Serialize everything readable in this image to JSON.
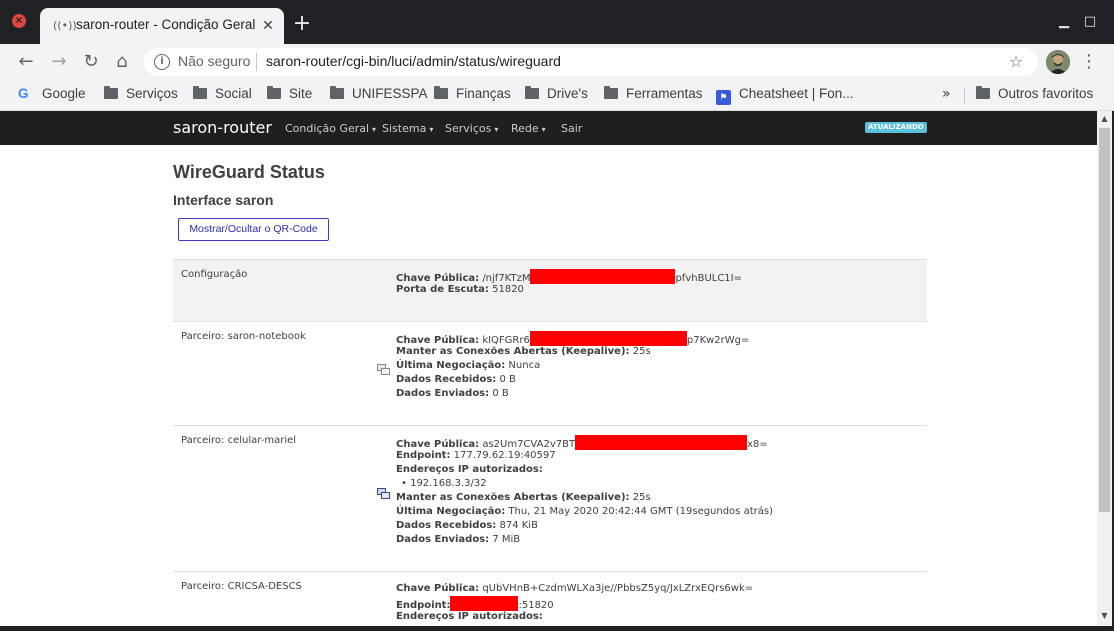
{
  "browser": {
    "tab_title": "saron-router - Condição Geral - LuCI",
    "tab_icon": "radio-waves-icon",
    "new_tab_label": "+",
    "security_text": "Não seguro",
    "url": "saron-router/cgi-bin/luci/admin/status/wireguard",
    "bookmarks": [
      {
        "label": "Google",
        "icon": "google-icon"
      },
      {
        "label": "Serviços",
        "icon": "folder-icon"
      },
      {
        "label": "Social",
        "icon": "folder-icon"
      },
      {
        "label": "Site",
        "icon": "folder-icon"
      },
      {
        "label": "UNIFESSPA",
        "icon": "folder-icon"
      },
      {
        "label": "Finanças",
        "icon": "folder-icon"
      },
      {
        "label": "Drive's",
        "icon": "folder-icon"
      },
      {
        "label": "Ferramentas",
        "icon": "folder-icon"
      },
      {
        "label": "Cheatsheet | Fon...",
        "icon": "flag-icon"
      }
    ],
    "bookmarks_more": "»",
    "other_bookmarks": "Outros favoritos"
  },
  "luci": {
    "brand": "saron-router",
    "nav": [
      {
        "label": "Condição Geral"
      },
      {
        "label": "Sistema"
      },
      {
        "label": "Serviços"
      },
      {
        "label": "Rede"
      },
      {
        "label": "Sair"
      }
    ],
    "badge": "ATUALIZANDO"
  },
  "main": {
    "title": "WireGuard Status",
    "interface_title": "Interface saron",
    "qr_button": "Mostrar/Ocultar o QR-Code",
    "config": {
      "label": "Configuração",
      "pubkey_label": "Chave Pública:",
      "pubkey_start": "/njf7KTzM",
      "pubkey_end": "pfvhBULC1I=",
      "port_label": "Porta de Escuta:",
      "port": "51820"
    },
    "peers": [
      {
        "label": "Parceiro: saron-notebook",
        "pubkey_label": "Chave Pública:",
        "pubkey_start": "kIQFGRr6",
        "pubkey_end": "p7Kw2rWg=",
        "keepalive_label": "Manter as Conexões Abertas (Keepalive):",
        "keepalive": "25s",
        "handshake_label": "Última Negociação:",
        "handshake": "Nunca",
        "rx_label": "Dados Recebidos:",
        "rx": "0 B",
        "tx_label": "Dados Enviados:",
        "tx": "0 B"
      },
      {
        "label": "Parceiro: celular-mariel",
        "pubkey_label": "Chave Pública:",
        "pubkey_start": "as2Um7CVA2v7BT",
        "pubkey_end": "x8=",
        "endpoint_label": "Endpoint:",
        "endpoint": "177.79.62.19:40597",
        "allowed_ips_label": "Endereços IP autorizados:",
        "allowed_ips": [
          "192.168.3.3/32"
        ],
        "keepalive_label": "Manter as Conexões Abertas (Keepalive):",
        "keepalive": "25s",
        "handshake_label": "Última Negociação:",
        "handshake": "Thu, 21 May 2020 20:42:44 GMT (19segundos atrás)",
        "rx_label": "Dados Recebidos:",
        "rx": "874 KiB",
        "tx_label": "Dados Enviados:",
        "tx": "7 MiB"
      },
      {
        "label": "Parceiro: CRICSA-DESCS",
        "pubkey_label": "Chave Pública:",
        "pubkey": "qUbVHnB+CzdmWLXa3je//PbbsZ5yq/JxLZrxEQrs6wk=",
        "endpoint_label": "Endpoint:",
        "endpoint_end": ":51820",
        "allowed_ips_label": "Endereços IP autorizados:"
      }
    ],
    "redaction_color": "#ff0000"
  }
}
